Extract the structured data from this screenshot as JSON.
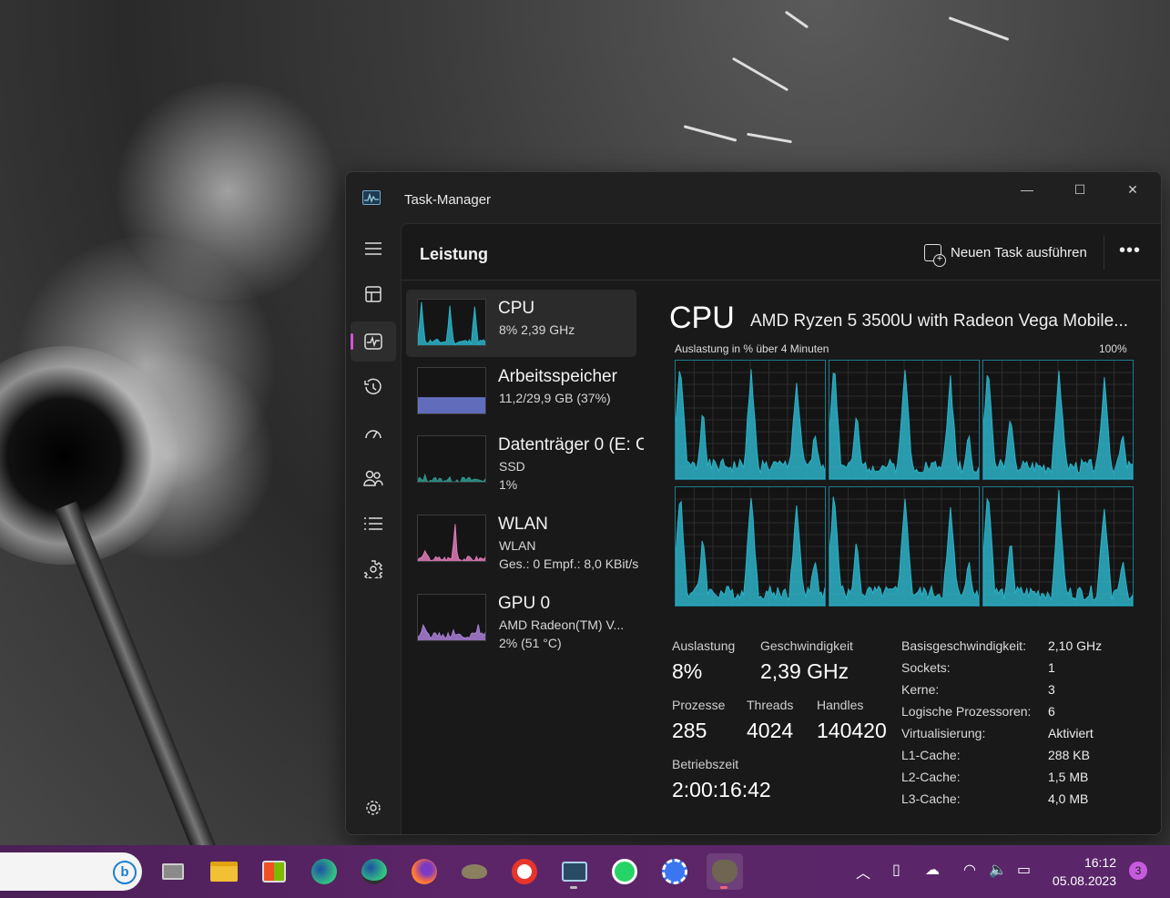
{
  "window": {
    "title": "Task-Manager",
    "minimize_icon": "minimize-icon",
    "maximize_icon": "maximize-icon",
    "close_icon": "close-icon"
  },
  "nav": {
    "items": [
      "hamburger-icon",
      "processes-icon",
      "performance-icon",
      "app-history-icon",
      "startup-icon",
      "users-icon",
      "details-icon",
      "services-icon",
      "settings-icon"
    ],
    "active": "performance-icon",
    "accent": "#d452d8"
  },
  "cmdbar": {
    "title": "Leistung",
    "new_task_label": "Neuen Task ausführen",
    "more_label": "•••"
  },
  "resources": [
    {
      "name": "CPU",
      "line1": "8%  2,39 GHz",
      "line2": "",
      "color": "#2bb2c7"
    },
    {
      "name": "Arbeitsspeicher",
      "line1": "11,2/29,9 GB (37%)",
      "line2": "",
      "color": "#6f7bd8"
    },
    {
      "name": "Datenträger 0 (E: C",
      "line1": "SSD",
      "line2": "1%",
      "color": "#2e9a8e"
    },
    {
      "name": "WLAN",
      "line1": "WLAN",
      "line2": "Ges.: 0  Empf.: 8,0 KBit/s",
      "color": "#e07ab8"
    },
    {
      "name": "GPU 0",
      "line1": "AMD Radeon(TM) V...",
      "line2": "2%  (51 °C)",
      "color": "#a97fd6"
    }
  ],
  "cpu": {
    "heading": "CPU",
    "model": "AMD Ryzen 5 3500U with Radeon Vega Mobile...",
    "graph_label": "Auslastung in % über 4 Minuten",
    "graph_max": "100%",
    "graph_color": "#2bb2c7",
    "stats": {
      "util_label": "Auslastung",
      "util_value": "8%",
      "speed_label": "Geschwindigkeit",
      "speed_value": "2,39 GHz",
      "proc_label": "Prozesse",
      "proc_value": "285",
      "threads_label": "Threads",
      "threads_value": "4024",
      "handles_label": "Handles",
      "handles_value": "140420",
      "uptime_label": "Betriebszeit",
      "uptime_value": "2:00:16:42"
    },
    "specs": [
      {
        "k": "Basisgeschwindigkeit:",
        "v": "2,10 GHz"
      },
      {
        "k": "Sockets:",
        "v": "1"
      },
      {
        "k": "Kerne:",
        "v": "3"
      },
      {
        "k": "Logische Prozessoren:",
        "v": "6"
      },
      {
        "k": "Virtualisierung:",
        "v": "Aktiviert"
      },
      {
        "k": "L1-Cache:",
        "v": "288 KB"
      },
      {
        "k": "L2-Cache:",
        "v": "1,5 MB"
      },
      {
        "k": "L3-Cache:",
        "v": "4,0 MB"
      }
    ]
  },
  "taskbar": {
    "search_icon": "bing-icon",
    "apps": [
      "task-view-icon",
      "file-explorer-icon",
      "store-icon",
      "edge-icon",
      "edge-dev-icon",
      "firefox-icon",
      "gimp-like-icon",
      "opera-icon",
      "task-manager-icon",
      "whatsapp-icon",
      "signal-icon",
      "gimp-icon"
    ],
    "clock_time": "16:12",
    "clock_date": "05.08.2023",
    "notification_count": "3"
  }
}
